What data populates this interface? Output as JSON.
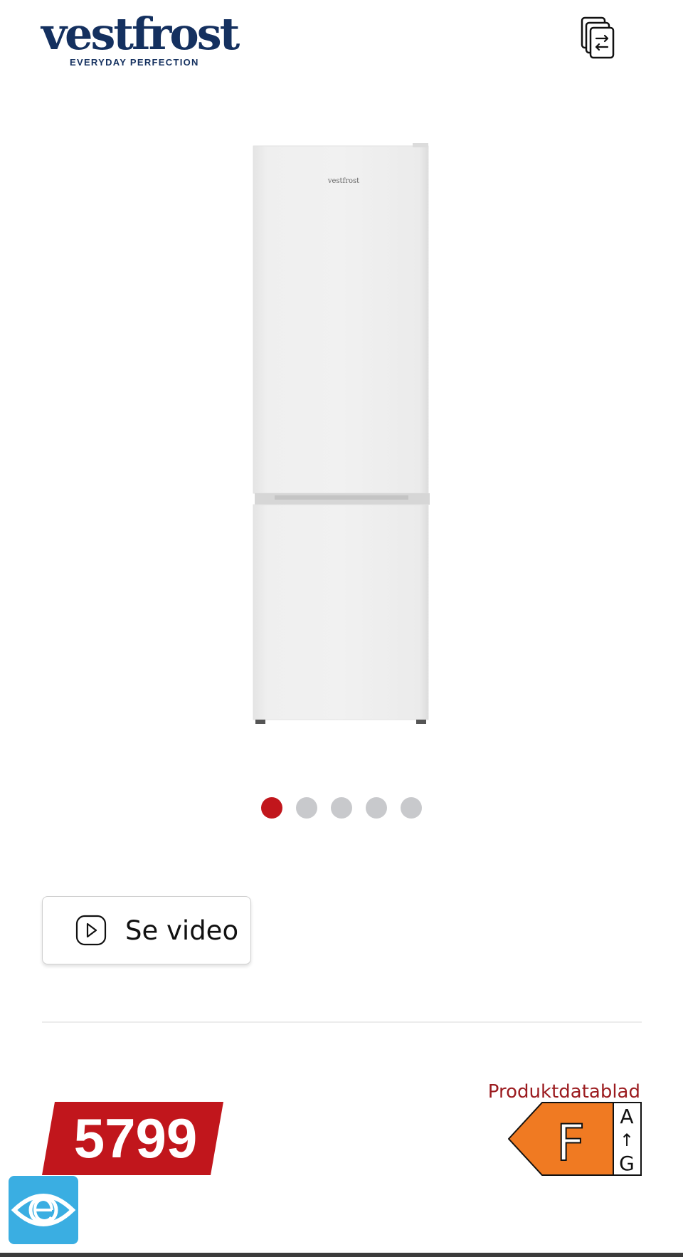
{
  "brand": {
    "name": "vestfrost",
    "tagline": "EVERYDAY PERFECTION",
    "color": "#14305f"
  },
  "header": {
    "compare_icon": "compare-icon"
  },
  "product": {
    "image_icon": "fridge-freezer-image",
    "image_brand_text": "vestfrost"
  },
  "gallery": {
    "dot_count": 5,
    "active_index": 0
  },
  "video": {
    "label": "Se video",
    "icon": "play-icon"
  },
  "price": {
    "value": "5799",
    "badge_color": "#c1161c"
  },
  "datasheet": {
    "label": "Produktdatablad",
    "color": "#9b1b1f"
  },
  "energy": {
    "class": "F",
    "scale_top": "A",
    "scale_arrow": "↑",
    "scale_bottom": "G",
    "color": "#f07a22"
  },
  "assist": {
    "icon": "eye-accessibility-icon",
    "color": "#3aaee2"
  }
}
